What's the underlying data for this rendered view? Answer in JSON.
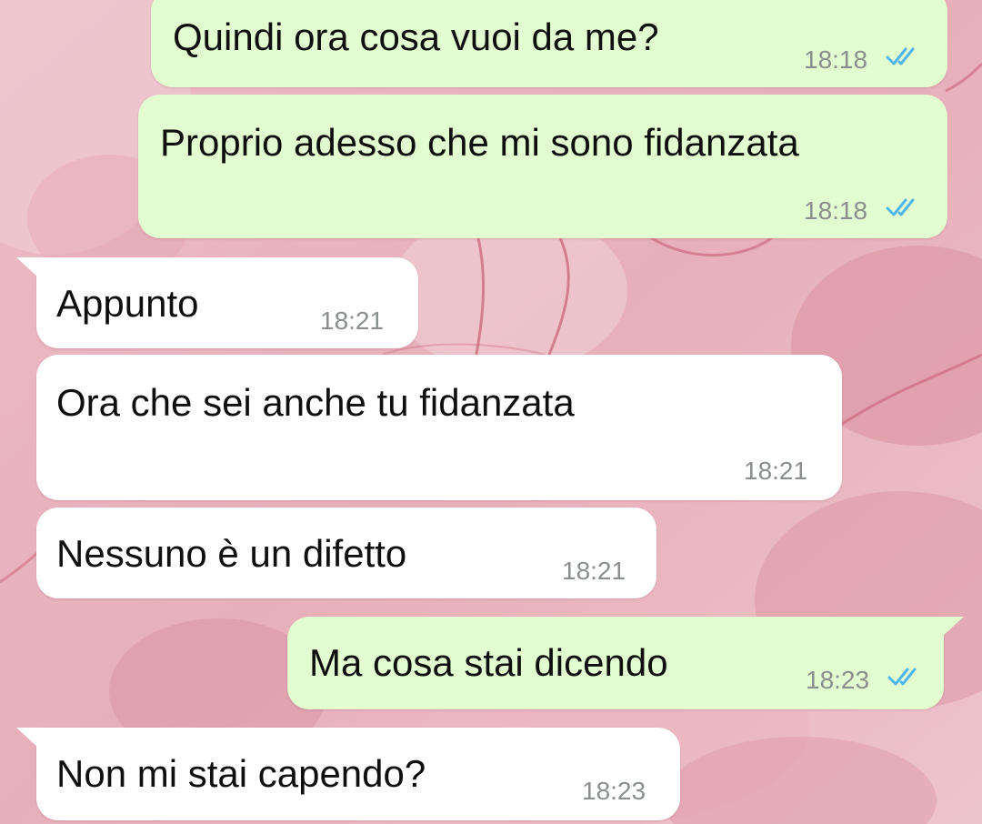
{
  "colors": {
    "outgoing_bubble": "#e2fdd0",
    "incoming_bubble": "#ffffff",
    "timestamp": "#8a8f8e",
    "read_ticks": "#4fb6ec",
    "wallpaper": "#e9b3bd"
  },
  "messages": [
    {
      "direction": "outgoing",
      "text": "Quindi ora cosa vuoi da me?",
      "time": "18:18",
      "status_icon": "double-check-read-icon"
    },
    {
      "direction": "outgoing",
      "text": "Proprio adesso che mi sono fidanzata",
      "time": "18:18",
      "status_icon": "double-check-read-icon"
    },
    {
      "direction": "incoming",
      "text": "Appunto",
      "time": "18:21"
    },
    {
      "direction": "incoming",
      "text": "Ora che sei anche tu fidanzata",
      "time": "18:21"
    },
    {
      "direction": "incoming",
      "text": "Nessuno è un difetto",
      "time": "18:21"
    },
    {
      "direction": "outgoing",
      "text": "Ma cosa stai dicendo",
      "time": "18:23",
      "status_icon": "double-check-read-icon"
    },
    {
      "direction": "incoming",
      "text": "Non mi stai capendo?",
      "time": "18:23"
    }
  ]
}
